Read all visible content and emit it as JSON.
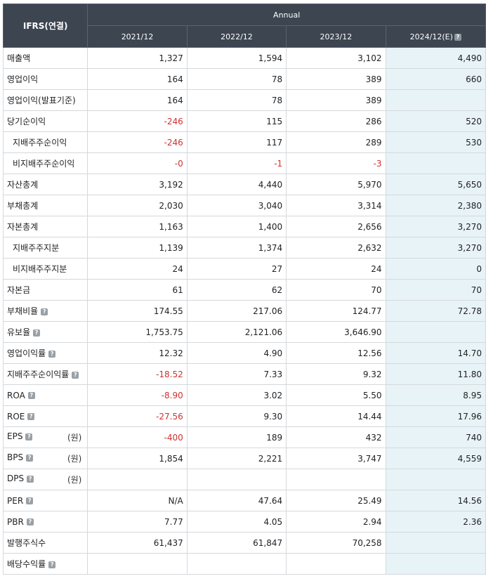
{
  "header": {
    "corner": "IFRS(연결)",
    "group": "Annual",
    "years": [
      "2021/12",
      "2022/12",
      "2023/12",
      "2024/12(E)"
    ]
  },
  "rows": [
    {
      "label": "매출액",
      "sub": false,
      "help": false,
      "unit": "",
      "values": [
        "1,327",
        "1,594",
        "3,102",
        "4,490"
      ]
    },
    {
      "label": "영업이익",
      "sub": false,
      "help": false,
      "unit": "",
      "values": [
        "164",
        "78",
        "389",
        "660"
      ]
    },
    {
      "label": "영업이익(발표기준)",
      "sub": false,
      "help": false,
      "unit": "",
      "values": [
        "164",
        "78",
        "389",
        ""
      ]
    },
    {
      "label": "당기순이익",
      "sub": false,
      "help": false,
      "unit": "",
      "values": [
        "-246",
        "115",
        "286",
        "520"
      ]
    },
    {
      "label": "지배주주순이익",
      "sub": true,
      "help": false,
      "unit": "",
      "values": [
        "-246",
        "117",
        "289",
        "530"
      ]
    },
    {
      "label": "비지배주주순이익",
      "sub": true,
      "help": false,
      "unit": "",
      "values": [
        "-0",
        "-1",
        "-3",
        ""
      ]
    },
    {
      "label": "자산총계",
      "sub": false,
      "help": false,
      "unit": "",
      "values": [
        "3,192",
        "4,440",
        "5,970",
        "5,650"
      ]
    },
    {
      "label": "부채총계",
      "sub": false,
      "help": false,
      "unit": "",
      "values": [
        "2,030",
        "3,040",
        "3,314",
        "2,380"
      ]
    },
    {
      "label": "자본총계",
      "sub": false,
      "help": false,
      "unit": "",
      "values": [
        "1,163",
        "1,400",
        "2,656",
        "3,270"
      ]
    },
    {
      "label": "지배주주지분",
      "sub": true,
      "help": false,
      "unit": "",
      "values": [
        "1,139",
        "1,374",
        "2,632",
        "3,270"
      ]
    },
    {
      "label": "비지배주주지분",
      "sub": true,
      "help": false,
      "unit": "",
      "values": [
        "24",
        "27",
        "24",
        "0"
      ]
    },
    {
      "label": "자본금",
      "sub": false,
      "help": false,
      "unit": "",
      "values": [
        "61",
        "62",
        "70",
        "70"
      ]
    },
    {
      "label": "부채비율",
      "sub": false,
      "help": true,
      "unit": "",
      "values": [
        "174.55",
        "217.06",
        "124.77",
        "72.78"
      ]
    },
    {
      "label": "유보율",
      "sub": false,
      "help": true,
      "unit": "",
      "values": [
        "1,753.75",
        "2,121.06",
        "3,646.90",
        ""
      ]
    },
    {
      "label": "영업이익률",
      "sub": false,
      "help": true,
      "unit": "",
      "values": [
        "12.32",
        "4.90",
        "12.56",
        "14.70"
      ]
    },
    {
      "label": "지배주주순이익률",
      "sub": false,
      "help": true,
      "unit": "",
      "values": [
        "-18.52",
        "7.33",
        "9.32",
        "11.80"
      ]
    },
    {
      "label": "ROA",
      "sub": false,
      "help": true,
      "unit": "",
      "values": [
        "-8.90",
        "3.02",
        "5.50",
        "8.95"
      ]
    },
    {
      "label": "ROE",
      "sub": false,
      "help": true,
      "unit": "",
      "values": [
        "-27.56",
        "9.30",
        "14.44",
        "17.96"
      ]
    },
    {
      "label": "EPS",
      "sub": false,
      "help": true,
      "unit": "(원)",
      "values": [
        "-400",
        "189",
        "432",
        "740"
      ]
    },
    {
      "label": "BPS",
      "sub": false,
      "help": true,
      "unit": "(원)",
      "values": [
        "1,854",
        "2,221",
        "3,747",
        "4,559"
      ]
    },
    {
      "label": "DPS",
      "sub": false,
      "help": true,
      "unit": "(원)",
      "values": [
        "",
        "",
        "",
        ""
      ]
    },
    {
      "label": "PER",
      "sub": false,
      "help": true,
      "unit": "",
      "values": [
        "N/A",
        "47.64",
        "25.49",
        "14.56"
      ]
    },
    {
      "label": "PBR",
      "sub": false,
      "help": true,
      "unit": "",
      "values": [
        "7.77",
        "4.05",
        "2.94",
        "2.36"
      ]
    },
    {
      "label": "발행주식수",
      "sub": false,
      "help": false,
      "unit": "",
      "values": [
        "61,437",
        "61,847",
        "70,258",
        ""
      ]
    },
    {
      "label": "배당수익률",
      "sub": false,
      "help": true,
      "unit": "",
      "values": [
        "",
        "",
        "",
        ""
      ]
    }
  ],
  "colors": {
    "header_bg": "#3c4550",
    "estimate_bg": "#e8f3f8",
    "negative": "#d03030"
  },
  "icons": {
    "help": "question-mark-icon"
  }
}
